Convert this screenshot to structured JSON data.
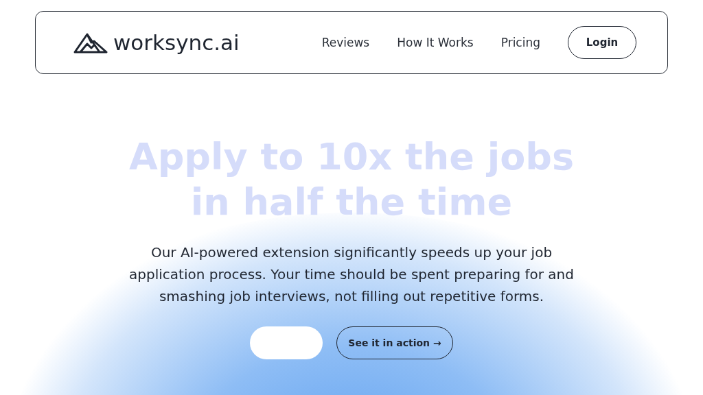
{
  "header": {
    "logo": "worksync.ai",
    "nav": [
      {
        "label": "Reviews"
      },
      {
        "label": "How It Works"
      },
      {
        "label": "Pricing"
      }
    ],
    "login": "Login"
  },
  "hero": {
    "title_lines": [
      "Apply to 10x the jobs",
      "in half the time"
    ],
    "description": "Our AI-powered extension significantly speeds up your job application process. Your time should be spent preparing for and smashing job interviews, not filling out repetitive forms.",
    "secondary_button": "See it in action →"
  }
}
